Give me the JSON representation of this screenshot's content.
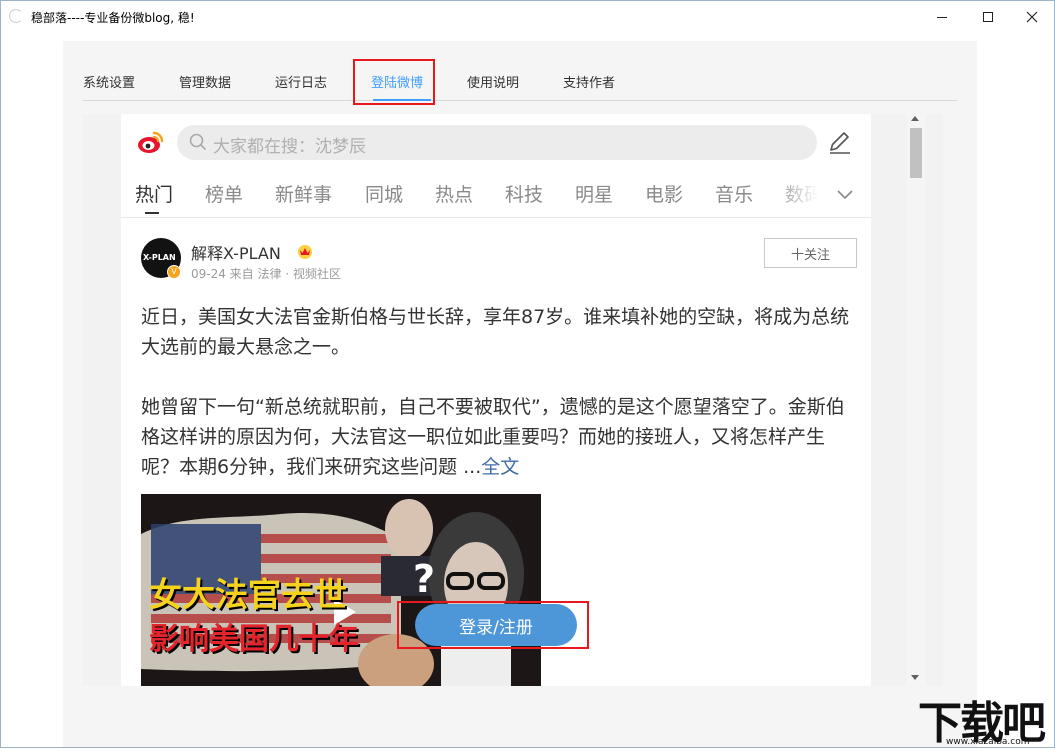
{
  "window": {
    "title": "稳部落----专业备份微blog, 稳!"
  },
  "tabs": [
    {
      "label": "系统设置"
    },
    {
      "label": "管理数据"
    },
    {
      "label": "运行日志"
    },
    {
      "label": "登陆微博",
      "active": true
    },
    {
      "label": "使用说明"
    },
    {
      "label": "支持作者"
    }
  ],
  "weibo": {
    "search_placeholder": "大家都在搜：沈梦辰",
    "channels": [
      "热门",
      "榜单",
      "新鲜事",
      "同城",
      "热点",
      "科技",
      "明星",
      "电影",
      "音乐",
      "数码"
    ],
    "active_channel": "热门",
    "post": {
      "avatar_text": "X-PLAN",
      "username": "解释X-PLAN",
      "meta": "09-24 来自 法律 · 视频社区",
      "follow_label": "十关注",
      "text_1": "近日，美国女大法官金斯伯格与世长辞，享年87岁。谁来填补她的空缺，将成为总统大选前的最大悬念之一。",
      "text_2": "她曾留下一句“新总统就职前，自己不要被取代”，遗憾的是这个愿望落空了。金斯伯格这样讲的原因为何，大法官这一职位如此重要吗？而她的接班人，又将怎样产生呢？本期6分钟，我们来研究这些问题 ...",
      "more_link": "全文",
      "thumb_title_1": "女大法官去世",
      "thumb_title_2": "影响美国几十年"
    },
    "login_label": "登录/注册"
  },
  "watermark": {
    "text": "下载吧",
    "url": "www.xiazaiba.com"
  },
  "colors": {
    "accent": "#409eff",
    "highlight": "#e8191c",
    "login": "#4d96d8"
  }
}
